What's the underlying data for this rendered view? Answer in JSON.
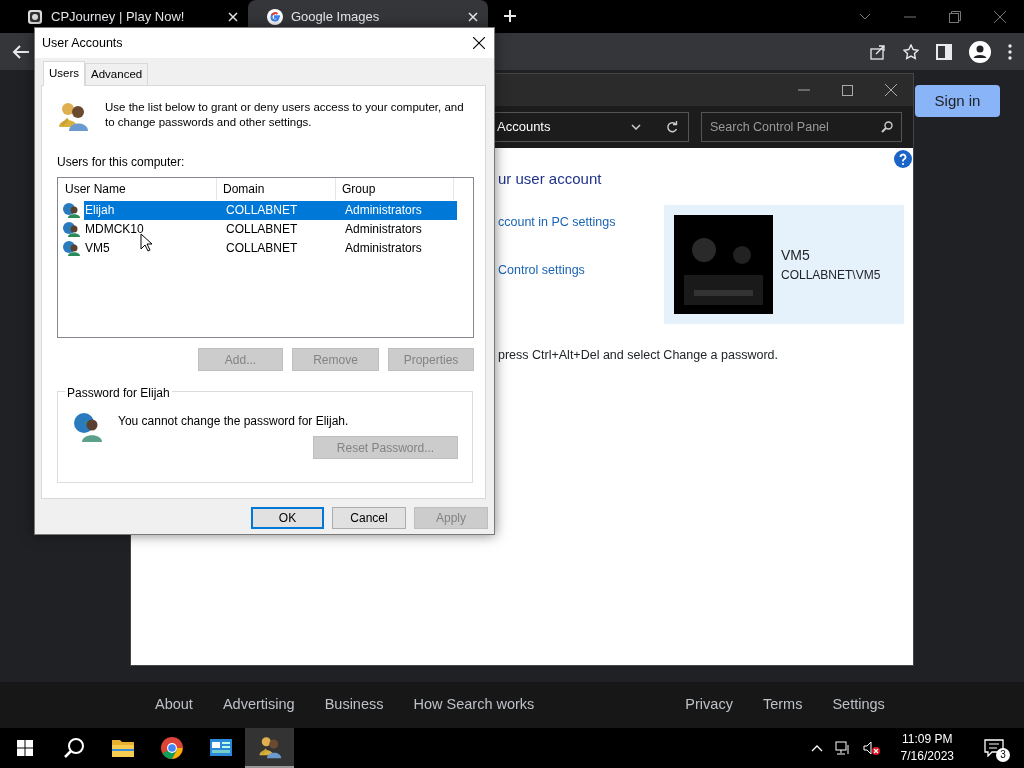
{
  "browser": {
    "tabs": [
      {
        "title": "CPJourney | Play Now!",
        "selected": false
      },
      {
        "title": "Google Images",
        "selected": true
      }
    ],
    "sign_in": "Sign in",
    "footer_left": [
      "About",
      "Advertising",
      "Business",
      "How Search works"
    ],
    "footer_right": [
      "Privacy",
      "Terms",
      "Settings"
    ]
  },
  "control_panel": {
    "address": "Accounts",
    "search_placeholder": "Search Control Panel",
    "heading": "ur user account",
    "links": [
      "ccount in PC settings",
      "Control settings"
    ],
    "account": {
      "name": "VM5",
      "full_name": "COLLABNET\\VM5"
    },
    "note": "press Ctrl+Alt+Del and select Change a password."
  },
  "dialog": {
    "title": "User Accounts",
    "tabs": [
      {
        "label": "Users",
        "selected": true
      },
      {
        "label": "Advanced",
        "selected": false
      }
    ],
    "intro": "Use the list below to grant or deny users access to your computer, and to change passwords and other settings.",
    "list_label": "Users for this computer:",
    "columns": [
      "User Name",
      "Domain",
      "Group"
    ],
    "rows": [
      {
        "cells": [
          "Elijah",
          "COLLABNET",
          "Administrators"
        ],
        "selected": true
      },
      {
        "cells": [
          "MDMCK10",
          "COLLABNET",
          "Administrators"
        ],
        "selected": false
      },
      {
        "cells": [
          "VM5",
          "COLLABNET",
          "Administrators"
        ],
        "selected": false
      }
    ],
    "list_buttons": [
      {
        "label": "Add...",
        "disabled": true
      },
      {
        "label": "Remove",
        "disabled": true
      },
      {
        "label": "Properties",
        "disabled": true
      }
    ],
    "password_group": {
      "title": "Password for Elijah",
      "message": "You cannot change the password for Elijah.",
      "button": {
        "label": "Reset Password...",
        "disabled": true
      }
    },
    "footer_buttons": [
      {
        "label": "OK",
        "disabled": false,
        "default": true
      },
      {
        "label": "Cancel",
        "disabled": false,
        "default": false
      },
      {
        "label": "Apply",
        "disabled": true,
        "default": false
      }
    ]
  },
  "taskbar": {
    "apps": [
      {
        "kind": "folder",
        "active": false
      },
      {
        "kind": "chrome",
        "active": false
      },
      {
        "kind": "control-panel",
        "active": false
      },
      {
        "kind": "users",
        "active": true
      }
    ],
    "clock": {
      "time": "11:09 PM",
      "date": "7/16/2023"
    },
    "notifications": "3"
  }
}
